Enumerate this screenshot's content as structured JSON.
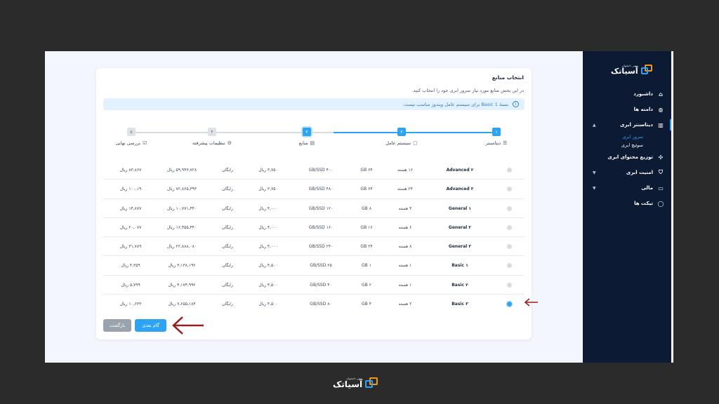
{
  "brand": {
    "name": "آسیاتک",
    "tagline": "عصر دانشهای",
    "colors": {
      "primary": "#2ea3f2",
      "accent": "#f39a1e",
      "sidebar": "#0d1a33",
      "annotation": "#9b1c1c"
    }
  },
  "sidebar": {
    "items": [
      {
        "label": "داشبورد",
        "icon": "home-icon",
        "has_children": false
      },
      {
        "label": "دامنه ها",
        "icon": "globe-icon",
        "has_children": false
      },
      {
        "label": "دیتاسنتر ابری",
        "icon": "datacenter-icon",
        "has_children": true,
        "expanded": true,
        "children": [
          {
            "label": "سرور ابری",
            "active": true
          },
          {
            "label": "سوئیچ ابری",
            "active": false
          }
        ]
      },
      {
        "label": "توزیع محتوای ابری",
        "icon": "cdn-icon",
        "has_children": false
      },
      {
        "label": "امنیت ابری",
        "icon": "shield-icon",
        "has_children": true
      },
      {
        "label": "مالی",
        "icon": "wallet-icon",
        "has_children": true
      },
      {
        "label": "تیکت ها",
        "icon": "chat-icon",
        "has_children": false
      }
    ]
  },
  "card": {
    "title": "انتخاب منابع",
    "subtitle": "در این بخش منابع مورد نیاز سرور ابری خود را انتخاب کنید.",
    "notice": "بستهٔ Basic 1 برای سیستم عامل ویندوز مناسب نیست.",
    "notice_icon": "info-icon"
  },
  "stepper": {
    "steps": [
      {
        "num": "۱",
        "label": "دیتاسنتر",
        "icon": "server-icon",
        "state": "done"
      },
      {
        "num": "۲",
        "label": "سیستم عامل",
        "icon": "os-icon",
        "state": "done"
      },
      {
        "num": "۳",
        "label": "منابع",
        "icon": "file-icon",
        "state": "current"
      },
      {
        "num": "۴",
        "label": "تنظیمات پیشرفته",
        "icon": "gear-icon",
        "state": "todo"
      },
      {
        "num": "۵",
        "label": "بررسی نهایی",
        "icon": "check-icon",
        "state": "todo"
      }
    ]
  },
  "plans": [
    {
      "plan": "Advanced ۲",
      "cpu": "۱۶ هسته",
      "ram": "۶۴ GB",
      "disk": "۴۰۰ GB/SSD",
      "bw": "۳,۷۵۰ ریال",
      "ip": "رایگان",
      "monthly": "۵۹,۹۴۳,۷۲۸ ریال",
      "hourly": "۸۳,۸۶۷ ریال",
      "selected": false
    },
    {
      "plan": "Advanced ۳",
      "cpu": "۲۴ هسته",
      "ram": "۶۴ GB",
      "disk": "۴۸۰ GB/SSD",
      "bw": "۳,۷۵۰ ریال",
      "ip": "رایگان",
      "monthly": "۷۲,۸۶۵,۳۹۳ ریال",
      "hourly": "۱۰۰,۱۹ ریال",
      "selected": false
    },
    {
      "plan": "General ۱",
      "cpu": "۴ هسته",
      "ram": "۸ GB",
      "disk": "۱۲۰ GB/SSD",
      "bw": "۴,۰۰۰ ریال",
      "ip": "رایگان",
      "monthly": "۱۰,۷۷۱,۴۴۰ ریال",
      "hourly": "۱۴,۸۷۷ ریال",
      "selected": false
    },
    {
      "plan": "General ۲",
      "cpu": "۶ هسته",
      "ram": "۱۶ GB",
      "disk": "۱۶۰ GB/SSD",
      "bw": "۴,۰۰۰ ریال",
      "ip": "رایگان",
      "monthly": "۱۶,۴۵۵,۴۴۰ ریال",
      "hourly": "۲۰,۰۷۷ ریال",
      "selected": false
    },
    {
      "plan": "General ۳",
      "cpu": "۸ هسته",
      "ram": "۲۴ GB",
      "disk": "۲۴۰ GB/SSD",
      "bw": "۴,۰۰۰ ریال",
      "ip": "رایگان",
      "monthly": "۲۲,۸۸۸,۰۸۰ ریال",
      "hourly": "۳۱,۷۸۹ ریال",
      "selected": false
    },
    {
      "plan": "Basic ۱",
      "cpu": "۱ هسته",
      "ram": "۱ GB",
      "disk": "۲۵ GB/SSD",
      "bw": "۴,۵۰۰ ریال",
      "ip": "رایگان",
      "monthly": "۳,۱۳۸,۱۹۲ ریال",
      "hourly": "۴,۳۵۹ ریال",
      "selected": false
    },
    {
      "plan": "Basic ۲",
      "cpu": "۱ هسته",
      "ram": "۲ GB",
      "disk": "۴۰ GB/SSD",
      "bw": "۴,۵۰۰ ریال",
      "ip": "رایگان",
      "monthly": "۴,۱۷۴,۹۹۲ ریال",
      "hourly": "۵,۷۹۹ ریال",
      "selected": false
    },
    {
      "plan": "Basic ۳",
      "cpu": "۲ هسته",
      "ram": "۴ GB",
      "disk": "۸۰ GB/SSD",
      "bw": "۴,۵۰۰ ریال",
      "ip": "رایگان",
      "monthly": "۷,۶۵۵,۱۸۴ ریال",
      "hourly": "۱۰,۶۳۳ ریال",
      "selected": true
    }
  ],
  "buttons": {
    "next": "گام بعدی",
    "back": "بازگشت"
  }
}
